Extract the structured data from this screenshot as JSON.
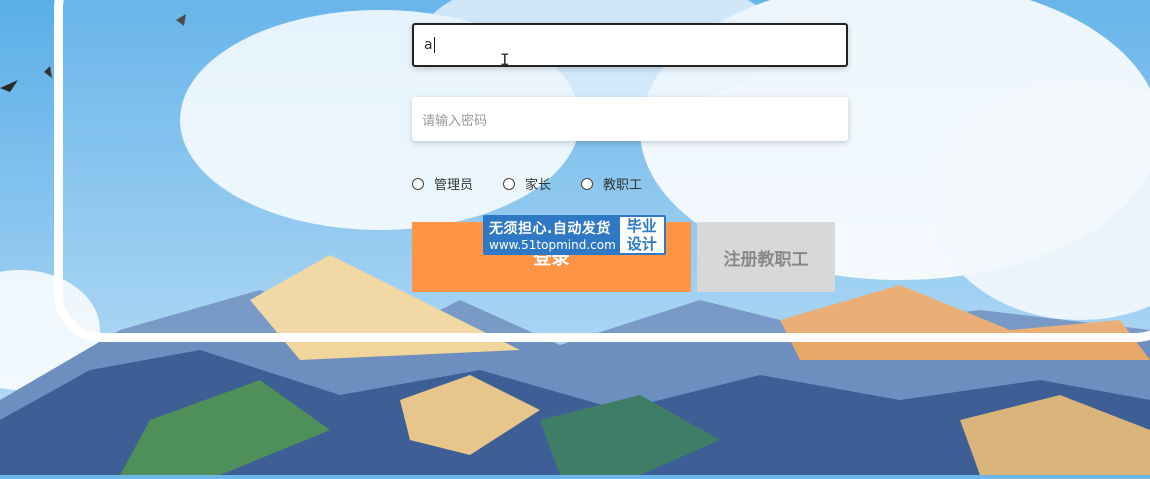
{
  "form": {
    "username_value": "a",
    "password_placeholder": "请输入密码"
  },
  "roles": [
    {
      "label": "管理员"
    },
    {
      "label": "家长"
    },
    {
      "label": "教职工"
    }
  ],
  "buttons": {
    "login_label": "登录",
    "register_label": "注册教职工"
  },
  "watermark": {
    "line1": "无须担心.自动发货",
    "line2": "www.51topmind.com",
    "badge_line1": "毕业",
    "badge_line2": "设计"
  },
  "colors": {
    "login_button": "#ff9446",
    "register_button": "#d8d8d8",
    "watermark": "#2f78c4"
  }
}
